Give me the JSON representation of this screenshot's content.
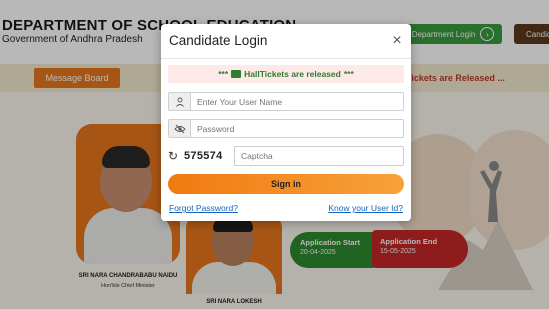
{
  "header": {
    "title": "DEPARTMENT OF SCHOOL EDUCATION",
    "subtitle": "Government of Andhra Pradesh",
    "department_login_label": "Department Login",
    "candidate_login_label": "Candidate Login"
  },
  "message_board_label": "Message Board",
  "ticker_text": "Tickets are Released ...",
  "leaders": [
    {
      "name": "SRI NARA CHANDRABABU NAIDU",
      "role": "Hon'ble Chief Minister"
    },
    {
      "name": "SRI NARA LOKESH"
    }
  ],
  "application": {
    "start_label": "Application Start",
    "start_date": "20-04-2025",
    "end_label": "Application End",
    "end_date": "15-05-2025"
  },
  "modal": {
    "title": "Candidate Login",
    "close_symbol": "×",
    "notice_prefix": "***",
    "notice_text": "HallTickets are released",
    "notice_suffix": "***",
    "username_placeholder": "Enter Your User Name",
    "password_placeholder": "Password",
    "refresh_symbol": "↻",
    "captcha_code": "575574",
    "captcha_placeholder": "Captcha",
    "signin_label": "Sign in",
    "forgot_password_label": "Forgot Password?",
    "know_user_id_label": "Know your User Id?"
  },
  "colors": {
    "accent_orange": "#e8771c",
    "green": "#2f8a2f",
    "red": "#c62828",
    "link_blue": "#1565c0"
  },
  "icons": {
    "user": "user-icon",
    "password": "eye-slash-icon",
    "refresh": "refresh-icon",
    "close": "close-icon",
    "arrow": "arrow-right-circle-icon",
    "hallticket": "hallticket-icon"
  }
}
